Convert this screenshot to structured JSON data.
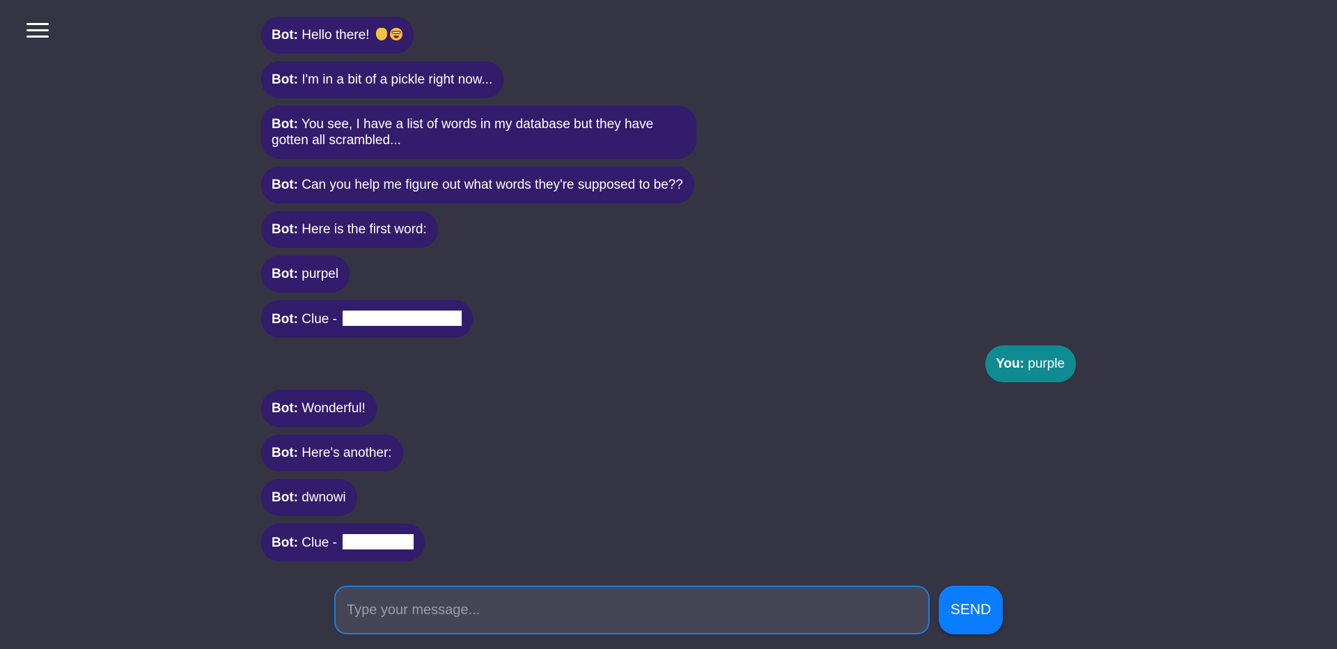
{
  "menu": {
    "icon": "hamburger-menu-icon"
  },
  "messages": [
    {
      "sender": "Bot:",
      "text": "Hello there!"
    },
    {
      "sender": "Bot:",
      "text": "I'm in a bit of a pickle right now..."
    },
    {
      "sender": "Bot:",
      "text": "You see, I have a list of words in my database but they have gotten all scrambled..."
    },
    {
      "sender": "Bot:",
      "text": "Can you help me figure out what words they're supposed to be??"
    },
    {
      "sender": "Bot:",
      "text": "Here is the first word:"
    },
    {
      "sender": "Bot:",
      "text": "purpel"
    },
    {
      "sender": "Bot:",
      "text": "Clue -"
    },
    {
      "sender": "You:",
      "text": "purple"
    },
    {
      "sender": "Bot:",
      "text": "Wonderful!"
    },
    {
      "sender": "Bot:",
      "text": "Here's another:"
    },
    {
      "sender": "Bot:",
      "text": "dwnowi"
    },
    {
      "sender": "Bot:",
      "text": "Clue -"
    }
  ],
  "colors": {
    "background": "#343442",
    "bot_bubble": "#331c6b",
    "user_bubble": "#0f8c91",
    "send_button": "#0a7cfe",
    "input_border": "#1e7fe0"
  },
  "composer": {
    "placeholder": "Type your message...",
    "value": "",
    "send_label": "SEND"
  }
}
